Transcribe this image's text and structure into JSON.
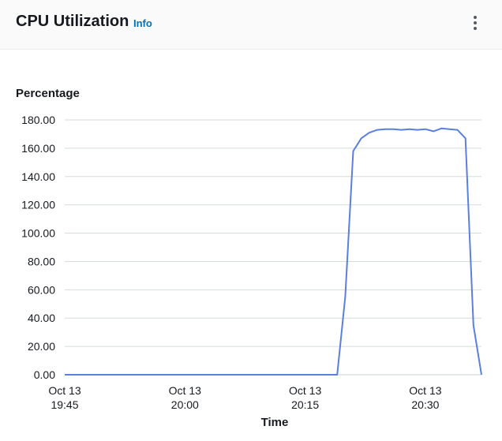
{
  "widget": {
    "title": "CPU Utilization",
    "info_label": "Info",
    "menu_icon": "kebab-menu-icon"
  },
  "colors": {
    "line": "#5a7fdc",
    "grid": "#d5dbdb",
    "info": "#0073bb"
  },
  "chart_data": {
    "type": "line",
    "title": "",
    "ylabel": "Percentage",
    "xlabel": "Time",
    "ylim": [
      0,
      180
    ],
    "yticks": [
      "0.00",
      "20.00",
      "40.00",
      "60.00",
      "80.00",
      "100.00",
      "120.00",
      "140.00",
      "160.00",
      "180.00"
    ],
    "xlim": [
      "2023-10-13 19:45",
      "2023-10-13 20:37"
    ],
    "xticks": [
      {
        "date": "Oct 13",
        "time": "19:45",
        "at": "2023-10-13 19:45"
      },
      {
        "date": "Oct 13",
        "time": "20:00",
        "at": "2023-10-13 20:00"
      },
      {
        "date": "Oct 13",
        "time": "20:15",
        "at": "2023-10-13 20:15"
      },
      {
        "date": "Oct 13",
        "time": "20:30",
        "at": "2023-10-13 20:30"
      }
    ],
    "grid": true,
    "series": [
      {
        "x": [
          "2023-10-13 19:45",
          "2023-10-13 20:00",
          "2023-10-13 20:15",
          "2023-10-13 20:19",
          "2023-10-13 20:20",
          "2023-10-13 20:21",
          "2023-10-13 20:22",
          "2023-10-13 20:23",
          "2023-10-13 20:24",
          "2023-10-13 20:25",
          "2023-10-13 20:26",
          "2023-10-13 20:27",
          "2023-10-13 20:28",
          "2023-10-13 20:29",
          "2023-10-13 20:30",
          "2023-10-13 20:31",
          "2023-10-13 20:32",
          "2023-10-13 20:33",
          "2023-10-13 20:34",
          "2023-10-13 20:35",
          "2023-10-13 20:36",
          "2023-10-13 20:37"
        ],
        "y": [
          0,
          0,
          0,
          0,
          55,
          158,
          167,
          171,
          173,
          173.5,
          173.5,
          173,
          173.5,
          173,
          173.5,
          172,
          174,
          173.5,
          173,
          167,
          35,
          0
        ]
      }
    ]
  }
}
